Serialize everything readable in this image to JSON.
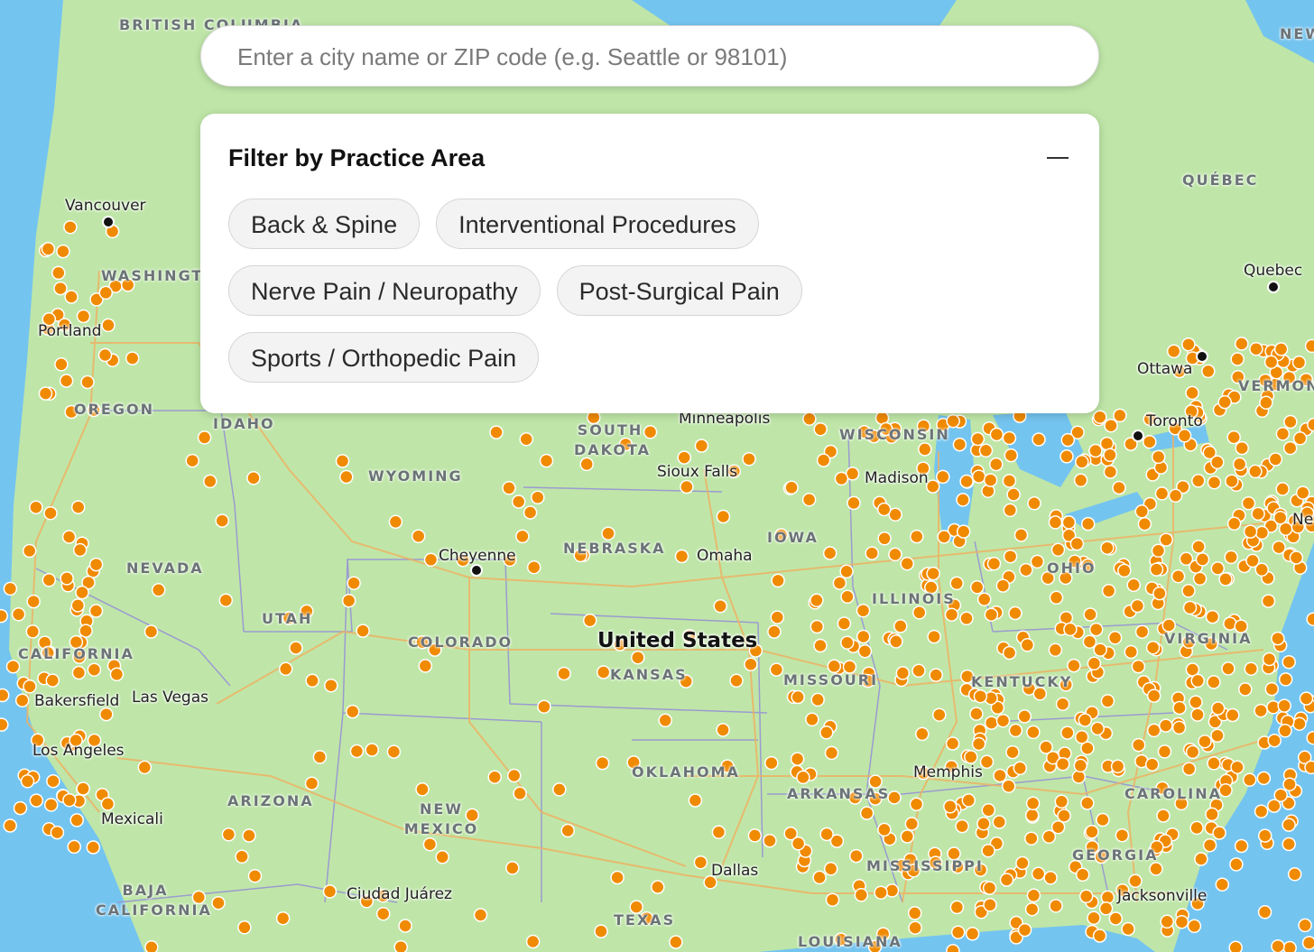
{
  "map": {
    "colors": {
      "land": "#bfe6a8",
      "water": "#74c4f0",
      "marker": "#f08a00",
      "road": "#f0b060",
      "border": "#9b9bd0"
    },
    "region_labels": [
      "BRITISH COLUMBIA",
      "WASHINGTON",
      "OREGON",
      "IDAHO",
      "NEVADA",
      "UTAH",
      "CALIFORNIA",
      "ARIZONA",
      "NEW MEXICO",
      "COLORADO",
      "WYOMING",
      "SOUTH DAKOTA",
      "NEBRASKA",
      "KANSAS",
      "OKLAHOMA",
      "TEXAS",
      "IOWA",
      "MISSOURI",
      "ILLINOIS",
      "ARKANSAS",
      "MISSISSIPPI",
      "LOUISIANA",
      "KENTUCKY",
      "VIRGINIA",
      "GEORGIA",
      "CAROLINA",
      "QUÉBEC",
      "VERMONT",
      "BAJA CALIFORNIA",
      "NEW",
      "WISCONSIN",
      "OHIO"
    ],
    "city_labels": [
      "Vancouver",
      "Portland",
      "Bakersfield",
      "Las Vegas",
      "Los Angeles",
      "Mexicali",
      "Cheyenne",
      "Sioux Falls",
      "Omaha",
      "Minneapolis",
      "Madison",
      "Memphis",
      "Dallas",
      "Ciudad Juárez",
      "Jacksonville",
      "Toronto",
      "Ottawa",
      "Quebec",
      "New York"
    ],
    "country_label": "United States"
  },
  "search": {
    "placeholder": "Enter a city name or ZIP code (e.g. Seattle or 98101)",
    "value": ""
  },
  "filter": {
    "title": "Filter by Practice Area",
    "chips": [
      "Back & Spine",
      "Interventional Procedures",
      "Nerve Pain / Neuropathy",
      "Post-Surgical Pain",
      "Sports / Orthopedic Pain"
    ]
  }
}
